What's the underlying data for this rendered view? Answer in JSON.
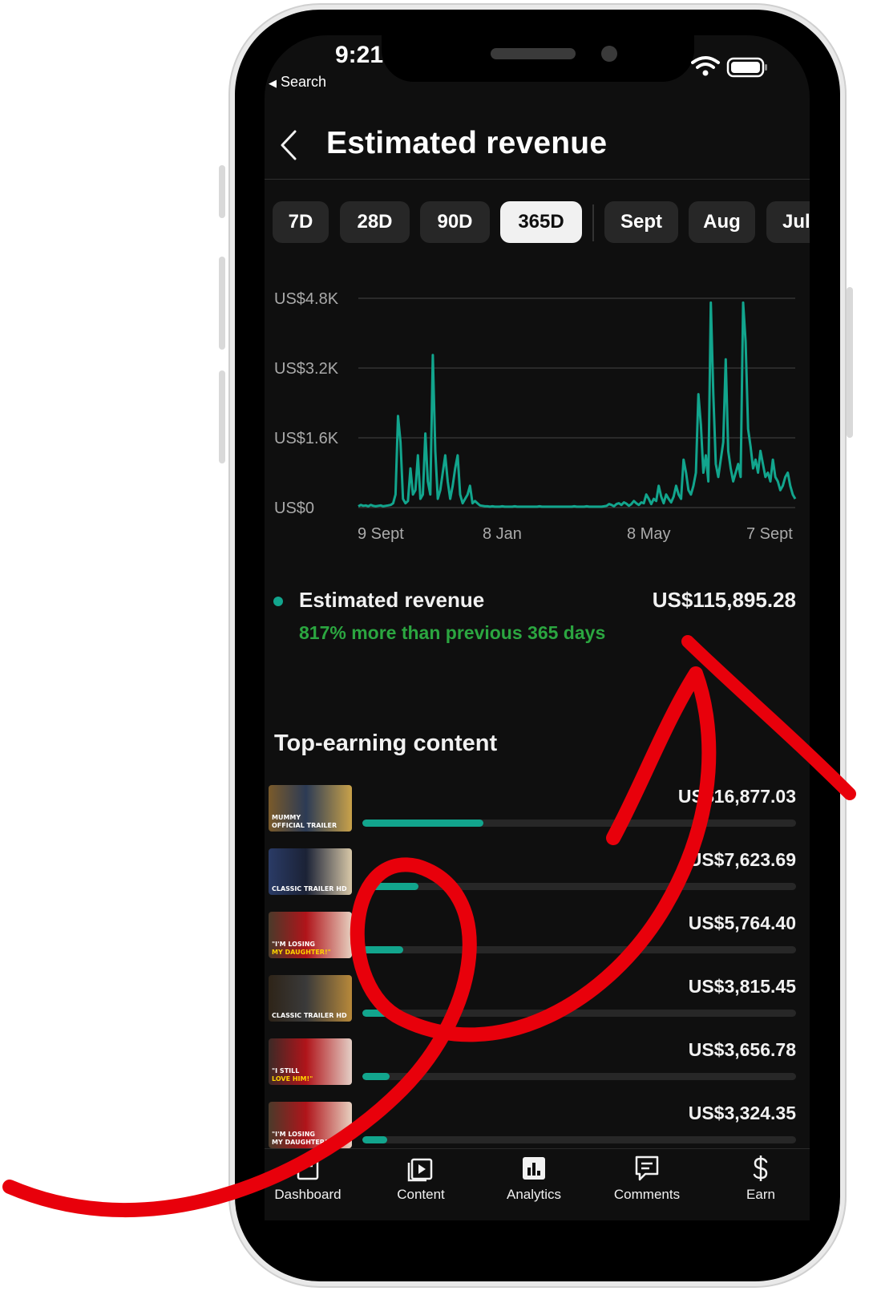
{
  "status_bar": {
    "time": "9:21",
    "back_label": "Search"
  },
  "header": {
    "title": "Estimated revenue"
  },
  "period_chips": [
    {
      "label": "7D",
      "selected": false
    },
    {
      "label": "28D",
      "selected": false
    },
    {
      "label": "90D",
      "selected": false
    },
    {
      "label": "365D",
      "selected": true
    },
    {
      "label": "Sept",
      "selected": false
    },
    {
      "label": "Aug",
      "selected": false
    },
    {
      "label": "Jul",
      "selected": false
    }
  ],
  "chart_data": {
    "type": "line",
    "x_tick_labels": [
      "9 Sept",
      "8 Jan",
      "8 May",
      "7 Sept"
    ],
    "y_tick_labels": [
      "US$4.8K",
      "US$3.2K",
      "US$1.6K",
      "US$0"
    ],
    "ylim": [
      0,
      4800
    ],
    "grid": true,
    "series": [
      {
        "color": "#12a58d",
        "values": [
          30,
          60,
          40,
          50,
          30,
          60,
          40,
          30,
          40,
          50,
          30,
          40,
          50,
          60,
          100,
          300,
          2100,
          1500,
          200,
          100,
          150,
          900,
          300,
          400,
          1200,
          200,
          300,
          1700,
          600,
          300,
          3500,
          1300,
          200,
          400,
          800,
          1200,
          600,
          200,
          500,
          900,
          1200,
          300,
          100,
          200,
          300,
          500,
          100,
          150,
          100,
          50,
          40,
          30,
          30,
          20,
          30,
          20,
          20,
          20,
          30,
          20,
          20,
          20,
          20,
          30,
          20,
          20,
          20,
          20,
          20,
          20,
          20,
          20,
          20,
          30,
          20,
          20,
          20,
          20,
          20,
          20,
          20,
          20,
          20,
          20,
          20,
          20,
          20,
          30,
          20,
          20,
          20,
          20,
          30,
          20,
          20,
          20,
          20,
          20,
          20,
          30,
          40,
          80,
          60,
          30,
          80,
          100,
          60,
          120,
          90,
          40,
          80,
          150,
          100,
          60,
          120,
          100,
          300,
          200,
          80,
          200,
          150,
          500,
          250,
          100,
          300,
          200,
          120,
          250,
          500,
          300,
          200,
          1100,
          800,
          400,
          300,
          500,
          800,
          2600,
          1900,
          800,
          1200,
          600,
          4700,
          2600,
          1000,
          700,
          1100,
          1500,
          3400,
          1300,
          900,
          600,
          800,
          1000,
          700,
          4700,
          3800,
          1800,
          1400,
          900,
          1100,
          800,
          1300,
          1000,
          700,
          800,
          600,
          1100,
          700,
          600,
          400,
          500,
          700,
          800,
          500,
          300,
          200
        ]
      }
    ]
  },
  "summary": {
    "metric": "Estimated revenue",
    "value": "US$115,895.28",
    "change": "817% more than previous 365 days",
    "dot_color": "#12a58d",
    "change_color": "#2ba640"
  },
  "top_content": {
    "title": "Top-earning content",
    "items": [
      {
        "value": "US$16,877.03",
        "share": 0.28,
        "thumb_text": [
          "MUMMY",
          "OFFICIAL TRAILER"
        ]
      },
      {
        "value": "US$7,623.69",
        "share": 0.13,
        "thumb_text": [
          "CLASSIC TRAILER HD"
        ]
      },
      {
        "value": "US$5,764.40",
        "share": 0.095,
        "thumb_text": [
          "\"I'M LOSING",
          "MY DAUGHTER!\""
        ]
      },
      {
        "value": "US$3,815.45",
        "share": 0.065,
        "thumb_text": [
          "CLASSIC TRAILER HD"
        ]
      },
      {
        "value": "US$3,656.78",
        "share": 0.062,
        "thumb_text": [
          "\"I STILL",
          "LOVE HIM!\""
        ]
      },
      {
        "value": "US$3,324.35",
        "share": 0.058,
        "thumb_text": [
          "\"I'M LOSING",
          "MY DAUGHTER!\""
        ]
      }
    ]
  },
  "tabs": [
    {
      "label": "Dashboard",
      "icon": "dashboard-icon"
    },
    {
      "label": "Content",
      "icon": "content-icon"
    },
    {
      "label": "Analytics",
      "icon": "analytics-icon"
    },
    {
      "label": "Comments",
      "icon": "comments-icon"
    },
    {
      "label": "Earn",
      "icon": "earn-icon"
    }
  ]
}
